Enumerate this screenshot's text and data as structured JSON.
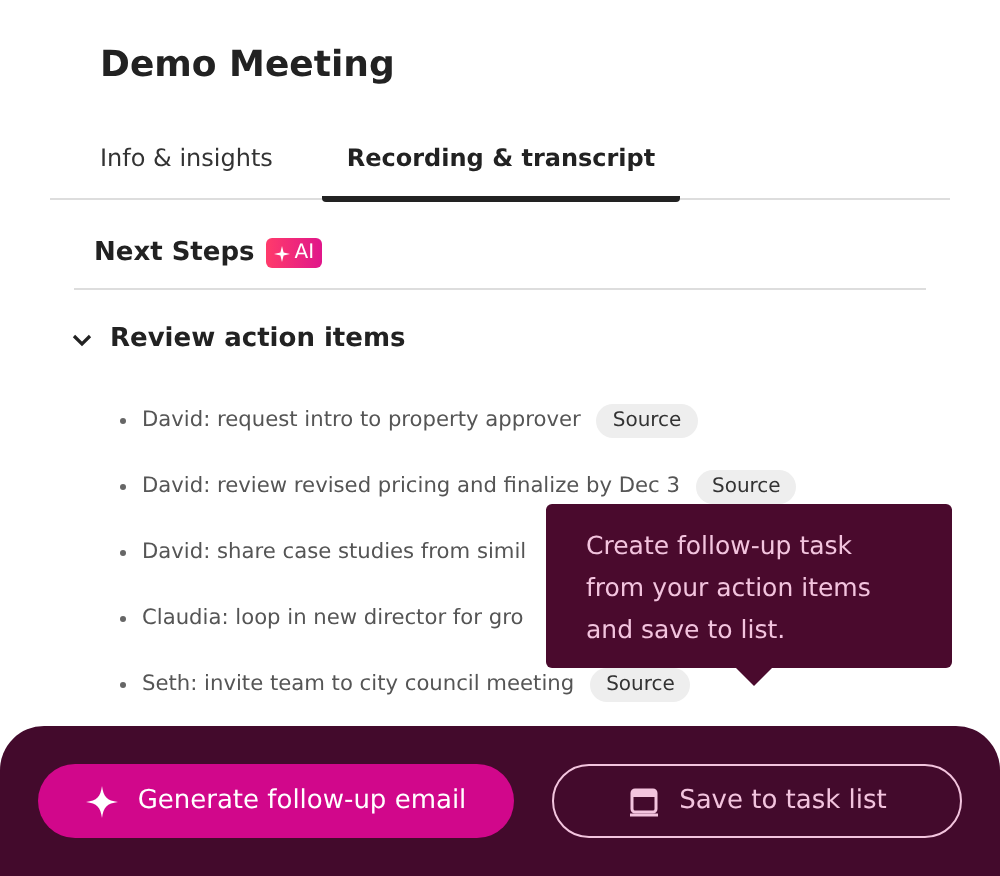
{
  "title": "Demo Meeting",
  "tabs": [
    {
      "label": "Info & insights",
      "selected": false
    },
    {
      "label": "Recording & transcript",
      "selected": true
    }
  ],
  "section": {
    "title": "Next Steps",
    "badge": "AI"
  },
  "group": {
    "title": "Review action items",
    "expanded": true,
    "items": [
      {
        "text": "David: request intro to property approver",
        "source": "Source"
      },
      {
        "text": "David: review revised pricing and finalize by Dec 3",
        "source": "Source"
      },
      {
        "text": "David: share case studies from simil"
      },
      {
        "text": "Claudia: loop in new director for gro"
      },
      {
        "text": "Seth: invite team to city council meeting",
        "source": "Source"
      }
    ]
  },
  "tooltip": "Create follow-up task from your action items and save to list.",
  "buttons": [
    {
      "label": "Generate follow-up email",
      "kind": "primary"
    },
    {
      "label": "Save to task list",
      "kind": "outline"
    }
  ]
}
